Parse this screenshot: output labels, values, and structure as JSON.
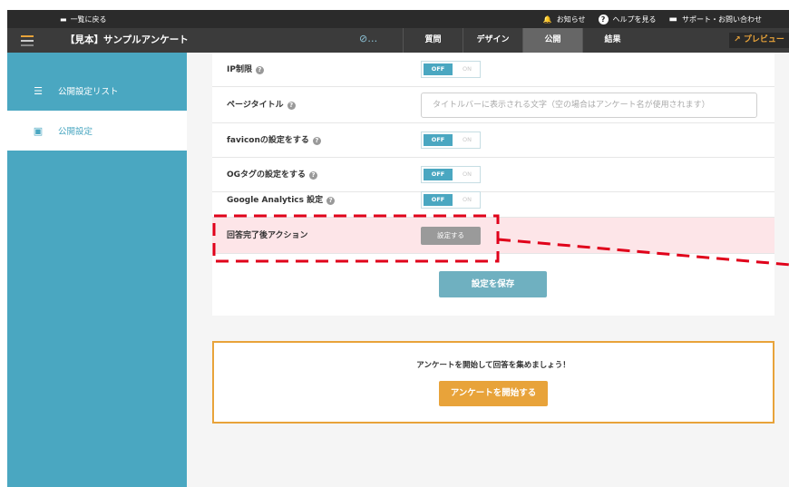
{
  "topbar": {
    "back_label": "一覧に戻る",
    "notice_label": "お知らせ",
    "help_label": "ヘルプを見る",
    "support_label": "サポート・お問い合わせ"
  },
  "navbar": {
    "survey_title": "【見本】サンプルアンケート",
    "status_indicator": "…",
    "tabs": [
      {
        "label": "質問"
      },
      {
        "label": "デザイン"
      },
      {
        "label": "公開"
      },
      {
        "label": "結果"
      }
    ],
    "active_tab": "公開",
    "preview_label": "プレビュー"
  },
  "sidebar": {
    "items": [
      {
        "label": "公開設定リスト",
        "icon": "list-icon"
      },
      {
        "label": "公開設定",
        "icon": "document-icon"
      }
    ]
  },
  "settings": {
    "rows": [
      {
        "label": "IP制限",
        "toggle_off": "OFF",
        "toggle_on": "ON"
      },
      {
        "label": "ページタイトル",
        "placeholder": "タイトルバーに表示される文字（空の場合はアンケート名が使用されます）"
      },
      {
        "label": "faviconの設定をする",
        "toggle_off": "OFF",
        "toggle_on": "ON"
      },
      {
        "label": "OGタグの設定をする",
        "toggle_off": "OFF",
        "toggle_on": "ON"
      },
      {
        "label": "Google Analytics 設定",
        "toggle_off": "OFF",
        "toggle_on": "ON"
      },
      {
        "label": "回答完了後アクション",
        "button": "設定する"
      }
    ],
    "save_label": "設定を保存"
  },
  "start": {
    "message": "アンケートを開始して回答を集めましょう！",
    "button": "アンケートを開始する"
  },
  "colors": {
    "accent": "#4aa7c1",
    "orange": "#e8a33a",
    "highlight_bg": "#fde5e8",
    "annotation_red": "#e0001a"
  }
}
